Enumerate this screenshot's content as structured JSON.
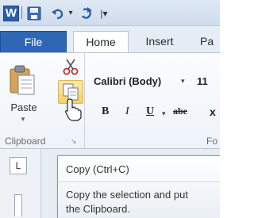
{
  "quick_access": {
    "app_icon": "word-logo-icon",
    "app_letter": "W",
    "buttons": [
      "save-icon",
      "undo-icon",
      "redo-icon",
      "customize-qat-icon"
    ],
    "dropdown_glyph": "▾",
    "more_glyph": "|▾"
  },
  "tabs": {
    "file": "File",
    "home": "Home",
    "insert": "Insert",
    "page": "Pa"
  },
  "clipboard": {
    "paste_label": "Paste",
    "paste_arrow": "▾",
    "group_label": "Clipboard",
    "launcher": "↘"
  },
  "font": {
    "name": "Calibri (Body)",
    "name_arrow": "▾",
    "size": "11",
    "bold": "B",
    "italic": "I",
    "underline": "U",
    "underline_arrow": "▾",
    "strikethrough": "abe",
    "subscript": "x",
    "group_label": "Fo"
  },
  "ruler": {
    "tab_selector": "L"
  },
  "tooltip": {
    "title": "Copy (Ctrl+C)",
    "body_line1": "Copy the selection and put",
    "body_line2": "the Clipboard."
  },
  "colors": {
    "file_tab": "#2f67b5",
    "copy_highlight": "#f8d063",
    "ribbon_bg": "#eef3f9"
  }
}
